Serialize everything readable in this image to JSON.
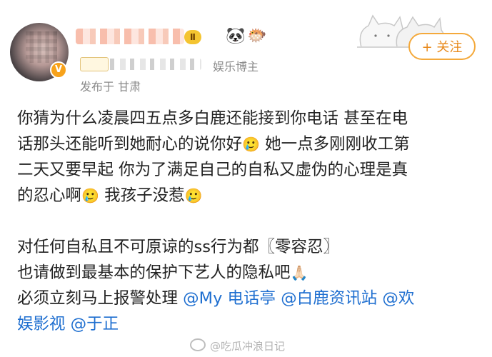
{
  "header": {
    "level_badge": "Ⅱ",
    "verified_badge": "V",
    "user_type": "娱乐博主",
    "origin": "发布于 甘肃",
    "follow_button": "+ 关注",
    "emojis": [
      "🐼",
      "🐡"
    ]
  },
  "post": {
    "paragraph1": [
      "你猜为什么凌晨四五点多白鹿还能接到你电话 甚至在电",
      "话那头还能听到她耐心的说你好",
      "🥲",
      " 她一点多刚刚收工第",
      "二天又要早起 你为了满足自己的自私又虚伪的心理是真",
      "的忍心啊",
      "🥲",
      " 我孩子没惹",
      "🥲"
    ],
    "line5": "对任何自私且不可原谅的ss行为都〖零容忍〗",
    "line6": "也请做到最基本的保护下艺人的隐私吧",
    "line6_emoji": "🙏🏻",
    "line7_prefix": "必须立刻马上报警处理 ",
    "mentions": [
      "@My 电话亭",
      "@白鹿资讯站",
      "@欢",
      "娱影视",
      "@于正"
    ]
  },
  "watermark": "@吃瓜冲浪日记"
}
